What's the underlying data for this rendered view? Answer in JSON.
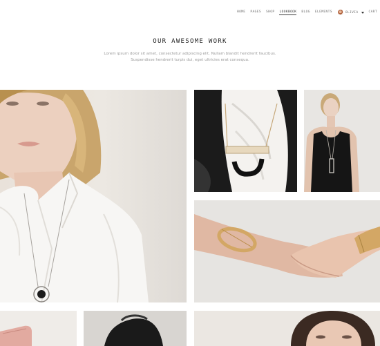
{
  "nav": {
    "items": [
      "HOME",
      "PAGES",
      "SHOP",
      "LOOKBOOK",
      "BLOG",
      "ELEMENTS"
    ],
    "active": "LOOKBOOK",
    "user": "OLIVIA",
    "cart": "CART"
  },
  "hero": {
    "title": "OUR AWESOME WORK",
    "subtitle_line1": "Lorem ipsum dolor sit amet, consectetur adipiscing elit. Nullam blandit hendrerit faucibus.",
    "subtitle_line2": "Suspendisse hendrerit turpis dui, eget ultricies erat consequa."
  },
  "colors": {
    "title": "#222222",
    "nav_text": "#6f6f6f",
    "subtitle": "#9a9a9a",
    "page_bg": "#ffffff"
  }
}
